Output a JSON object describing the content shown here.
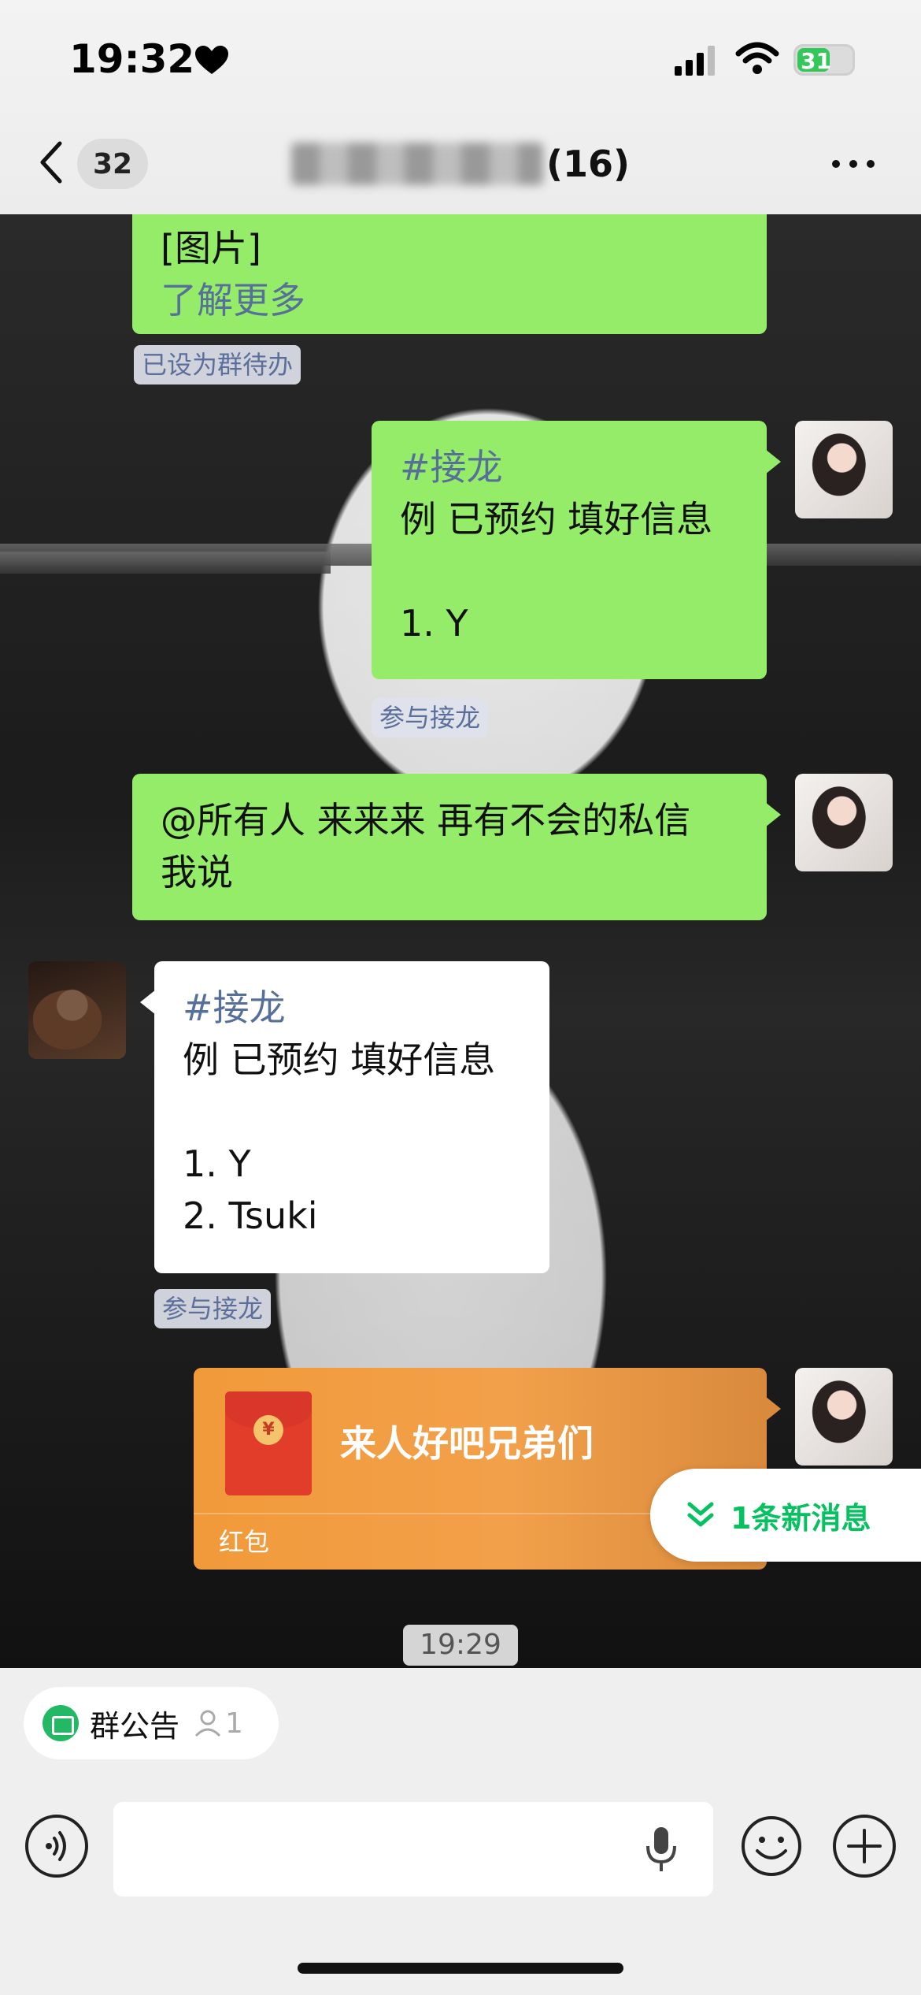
{
  "status_bar": {
    "time": "19:32",
    "battery": "31",
    "battery_level_percent": 31,
    "icons": [
      "heart-icon",
      "signal-icon",
      "wifi-icon",
      "battery-charging-icon"
    ]
  },
  "nav": {
    "unread_count": "32",
    "group_title_suffix": "(16)"
  },
  "messages": [
    {
      "side": "right",
      "lines": [
        "[图片]",
        "了解更多"
      ],
      "chip": "已设为群待办"
    },
    {
      "side": "right",
      "tag": "#接龙",
      "lines": [
        "例 已预约 填好信息",
        "",
        "1. Y"
      ],
      "chip": "参与接龙"
    },
    {
      "side": "right",
      "lines": [
        "@所有人 来来来 再有不会的私信",
        "我说"
      ]
    },
    {
      "side": "left",
      "tag": "#接龙",
      "lines": [
        "例 已预约 填好信息",
        "",
        "1. Y",
        "2. Tsuki"
      ],
      "chip": "参与接龙"
    }
  ],
  "red_packet": {
    "title": "来人好吧兄弟们",
    "label": "红包",
    "coin": "¥"
  },
  "new_message_pill": "1条新消息",
  "timestamp": "19:29",
  "group_notice": {
    "label": "群公告",
    "count": "1"
  },
  "colors": {
    "bubble_green": "#95ec69",
    "accent_green": "#07c160",
    "red_packet": "#f19a3a",
    "link_blue": "#56709a"
  }
}
